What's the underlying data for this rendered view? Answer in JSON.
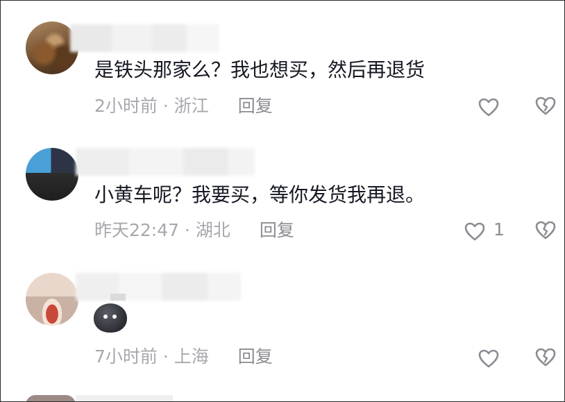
{
  "comments": [
    {
      "text": "是铁头那家么？我也想买，然后再退货",
      "time": "2小时前",
      "location": "浙江",
      "separator": "·",
      "reply": "回复",
      "likes": ""
    },
    {
      "text": "小黄车呢？我要买，等你发货我再退。",
      "time": "昨天22:47",
      "location": "湖北",
      "separator": "·",
      "reply": "回复",
      "likes": "1"
    },
    {
      "text": "",
      "time": "7小时前",
      "location": "上海",
      "separator": "·",
      "reply": "回复",
      "likes": ""
    }
  ],
  "icons": {
    "like": "heart-outline-icon",
    "dislike": "broken-heart-icon",
    "emoji": "dark-blob-emoji-icon"
  },
  "colors": {
    "meta_gray": "#a6a8ad",
    "text_dark": "#161823"
  }
}
